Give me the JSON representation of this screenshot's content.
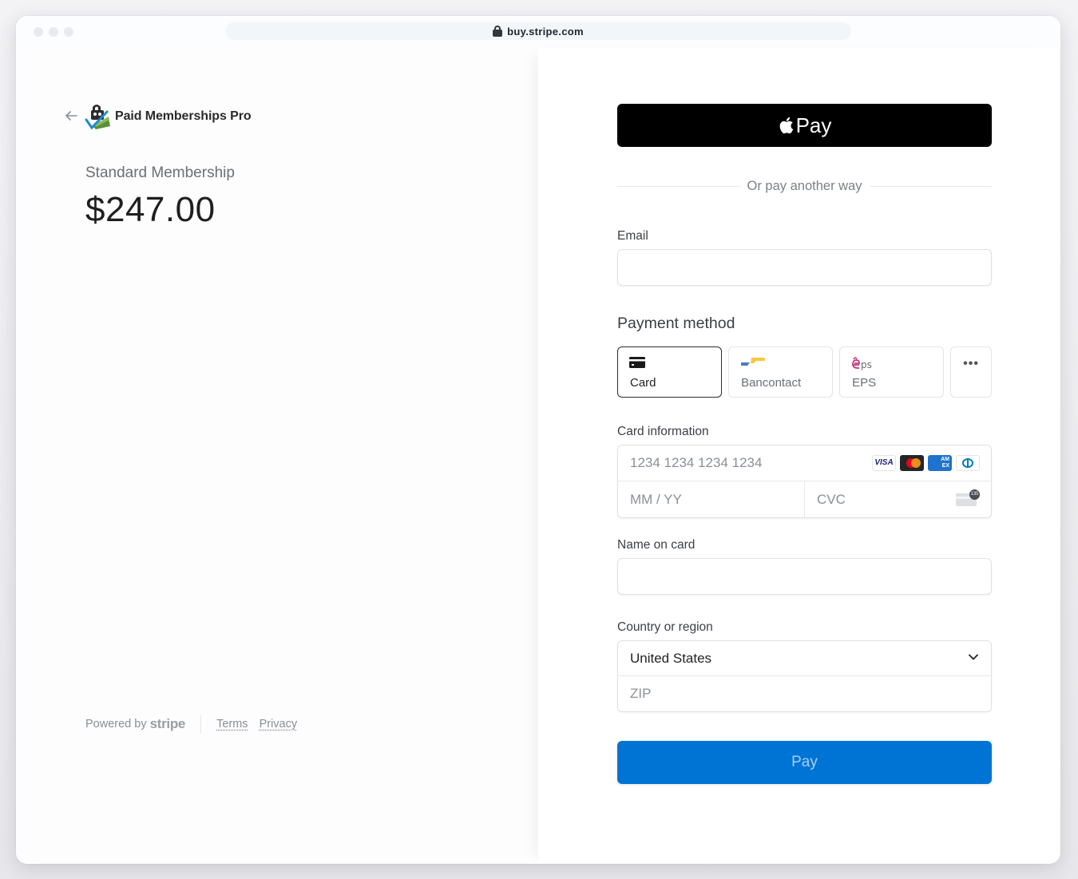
{
  "browser": {
    "url": "buy.stripe.com"
  },
  "merchant": {
    "name": "Paid Memberships Pro"
  },
  "product": {
    "name": "Standard Membership",
    "price": "$247.00"
  },
  "footer": {
    "powered_by": "Powered by",
    "stripe_wordmark": "stripe",
    "links": [
      "Terms",
      "Privacy"
    ]
  },
  "checkout": {
    "apple_pay_label": "Pay",
    "divider_text": "Or pay another way",
    "email": {
      "label": "Email",
      "value": ""
    },
    "payment_method": {
      "title": "Payment method",
      "options": [
        {
          "label": "Card",
          "icon": "credit-card-icon",
          "selected": true
        },
        {
          "label": "Bancontact",
          "icon": "bancontact-logo",
          "selected": false
        },
        {
          "label": "EPS",
          "icon": "eps-logo",
          "selected": false
        },
        {
          "label": "",
          "icon": "more-dots-icon",
          "selected": false
        }
      ]
    },
    "card_info": {
      "label": "Card information",
      "number_placeholder": "1234 1234 1234 1234",
      "expiry_placeholder": "MM / YY",
      "cvc_placeholder": "CVC",
      "brands": [
        "VISA",
        "Mastercard",
        "AMEX",
        "Diners Club"
      ],
      "cvc_badge": "135"
    },
    "name_on_card": {
      "label": "Name on card",
      "value": ""
    },
    "country": {
      "label": "Country or region",
      "selected": "United States",
      "zip_placeholder": "ZIP"
    },
    "pay_button": "Pay"
  },
  "colors": {
    "pay_button": "#0074d4",
    "apple_pay": "#000000",
    "eps_pink": "#c8387a"
  }
}
